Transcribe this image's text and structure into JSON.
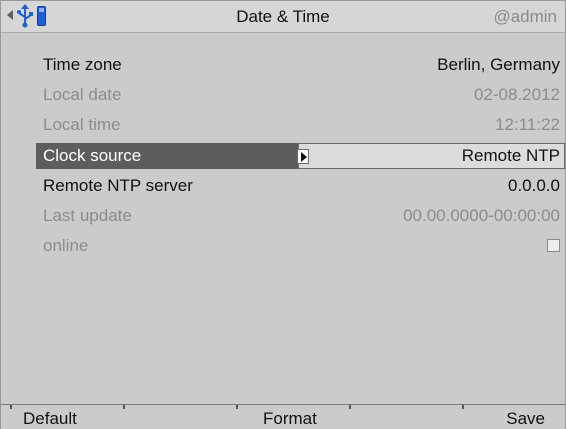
{
  "header": {
    "title": "Date & Time",
    "user": "@admin",
    "icons": [
      "back-arrow-icon",
      "usb-icon",
      "storage-icon"
    ]
  },
  "rows": [
    {
      "label": "Time zone",
      "value": "Berlin, Germany",
      "enabled": true
    },
    {
      "label": "Local date",
      "value": "02-08.2012",
      "enabled": false
    },
    {
      "label": "Local time",
      "value": "12:11:22",
      "enabled": false
    },
    {
      "label": "Clock source",
      "value": "Remote NTP",
      "enabled": true,
      "selected": true
    },
    {
      "label": "Remote NTP server",
      "value": "0.0.0.0",
      "enabled": true
    },
    {
      "label": "Last update",
      "value": "00.00.0000-00:00:00",
      "enabled": false
    },
    {
      "label": "online",
      "checked": false,
      "enabled": false
    }
  ],
  "footer": {
    "default_label": "Default",
    "format_label": "Format",
    "save_label": "Save"
  },
  "colors": {
    "background": "#cbcbcb",
    "selected_row": "#5d5d5d",
    "icon_blue": "#1f5fd6"
  }
}
